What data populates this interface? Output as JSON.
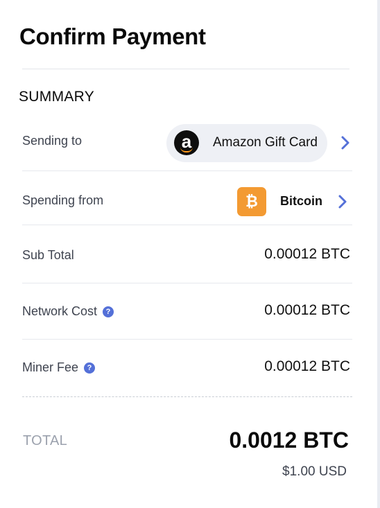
{
  "page": {
    "title": "Confirm Payment"
  },
  "summary": {
    "heading": "SUMMARY",
    "sending_to": {
      "label": "Sending to",
      "value": "Amazon Gift Card",
      "icon": "amazon-logo-icon"
    },
    "spending_from": {
      "label": "Spending from",
      "value": "Bitcoin",
      "icon": "bitcoin-icon",
      "icon_glyph": "₿"
    },
    "sub_total": {
      "label": "Sub Total",
      "value": "0.00012 BTC"
    },
    "network_cost": {
      "label": "Network Cost",
      "value": "0.00012 BTC"
    },
    "miner_fee": {
      "label": "Miner Fee",
      "value": "0.00012 BTC"
    }
  },
  "total": {
    "label": "TOTAL",
    "value": "0.0012 BTC",
    "fiat": "$1.00 USD"
  },
  "icons": {
    "help": "?",
    "amazon_glyph": "a"
  },
  "colors": {
    "accent": "#5470d8",
    "bitcoin": "#f39a32",
    "pill_bg": "#eef0f5",
    "muted": "#9ba1ad"
  }
}
